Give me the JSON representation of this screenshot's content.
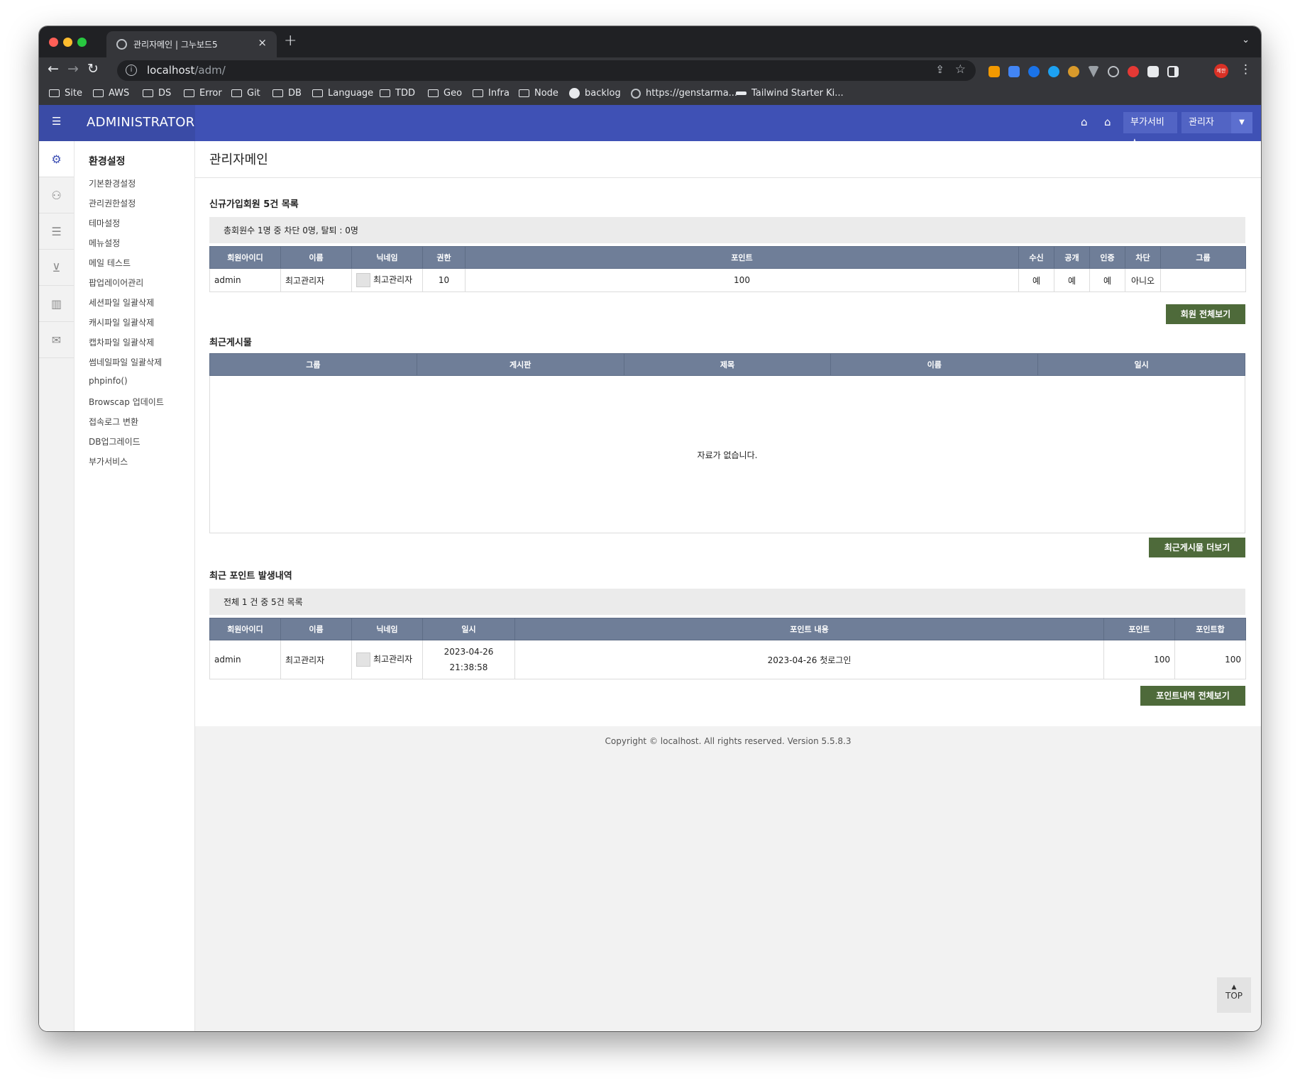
{
  "browser": {
    "tab_title": "관리자메인 | 그누보드5",
    "url_host": "localhost",
    "url_path": "/adm/",
    "bookmarks": [
      "Site",
      "AWS",
      "DS",
      "Error",
      "Git",
      "DB",
      "Language",
      "TDD",
      "Geo",
      "Infra",
      "Node",
      "backlog",
      "https://genstarma...",
      "Tailwind Starter Ki..."
    ],
    "profile_label": "제한"
  },
  "header": {
    "brand": "ADMINISTRATOR",
    "addon_label": "부가서비스",
    "admin_label": "관리자"
  },
  "sidebar": {
    "title": "환경설정",
    "items": [
      "기본환경설정",
      "관리권한설정",
      "테마설정",
      "메뉴설정",
      "메일 테스트",
      "팝업레이어관리",
      "세션파일 일괄삭제",
      "캐시파일 일괄삭제",
      "캡차파일 일괄삭제",
      "썸네일파일 일괄삭제",
      "phpinfo()",
      "Browscap 업데이트",
      "접속로그 변환",
      "DB업그레이드",
      "부가서비스"
    ]
  },
  "main": {
    "page_title": "관리자메인",
    "members": {
      "title": "신규가입회원 5건 목록",
      "summary": "총회원수 1명 중 차단 0명, 탈퇴 : 0명",
      "columns": [
        "회원아이디",
        "이름",
        "닉네임",
        "권한",
        "포인트",
        "수신",
        "공개",
        "인증",
        "차단",
        "그룹"
      ],
      "rows": [
        [
          "admin",
          "최고관리자",
          "최고관리자",
          "10",
          "100",
          "예",
          "예",
          "예",
          "아니오",
          ""
        ]
      ],
      "more_button": "회원 전체보기"
    },
    "posts": {
      "title": "최근게시물",
      "columns": [
        "그룹",
        "게시판",
        "제목",
        "이름",
        "일시"
      ],
      "empty_text": "자료가 없습니다.",
      "more_button": "최근게시물 더보기"
    },
    "points": {
      "title": "최근 포인트 발생내역",
      "summary": "전체 1 건 중 5건 목록",
      "columns": [
        "회원아이디",
        "이름",
        "닉네임",
        "일시",
        "포인트 내용",
        "포인트",
        "포인트합"
      ],
      "rows": [
        [
          "admin",
          "최고관리자",
          "최고관리자",
          "2023-04-26 21:38:58",
          "2023-04-26 첫로그인",
          "100",
          "100"
        ]
      ],
      "more_button": "포인트내역 전체보기"
    }
  },
  "footer": {
    "text": "Copyright © localhost. All rights reserved. Version 5.5.8.3"
  },
  "top_button": "TOP"
}
